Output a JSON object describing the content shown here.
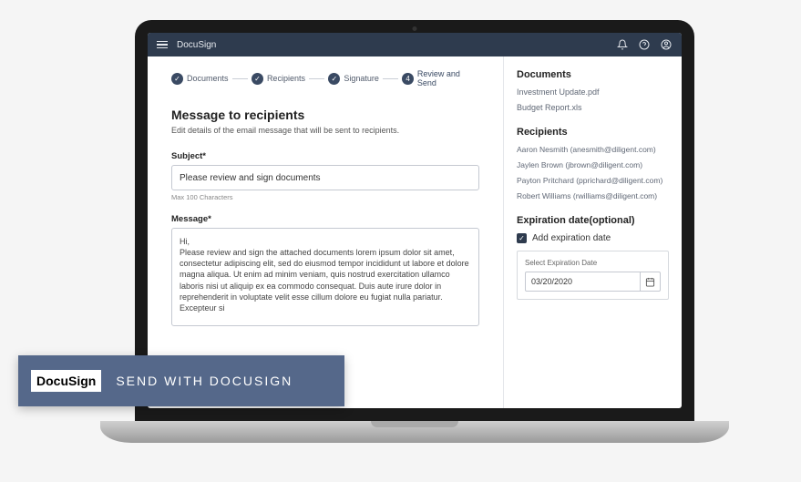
{
  "app": {
    "title": "DocuSign"
  },
  "stepper": [
    {
      "label": "Documents",
      "done": true
    },
    {
      "label": "Recipients",
      "done": true
    },
    {
      "label": "Signature",
      "done": true
    },
    {
      "label": "Review and Send",
      "active_num": "4"
    }
  ],
  "page": {
    "title": "Message to recipients",
    "subtitle": "Edit details of the email message that will be sent to recipients."
  },
  "form": {
    "subject_label": "Subject*",
    "subject_value": "Please review and sign documents",
    "subject_helper": "Max 100 Characters",
    "message_label": "Message*",
    "message_value": "Hi,\nPlease review and sign the attached documents lorem ipsum dolor sit amet, consectetur adipiscing elit, sed do eiusmod tempor incididunt ut labore et dolore magna aliqua. Ut enim ad minim veniam, quis nostrud exercitation ullamco laboris nisi ut aliquip ex ea commodo consequat. Duis aute irure dolor in reprehenderit in voluptate velit esse cillum dolore eu fugiat nulla pariatur. Excepteur si"
  },
  "documents": {
    "title": "Documents",
    "items": [
      "Investment Update.pdf",
      "Budget Report.xls"
    ]
  },
  "recipients": {
    "title": "Recipients",
    "items": [
      "Aaron Nesmith (anesmith@diligent.com)",
      "Jaylen Brown (jbrown@diligent.com)",
      "Payton Pritchard (pprichard@diligent.com)",
      "Robert Williams (rwilliams@diligent.com)"
    ]
  },
  "expiration": {
    "title": "Expiration date(optional)",
    "checkbox_label": "Add expiration date",
    "checked": true,
    "date_label": "Select Expiration Date",
    "date_value": "03/20/2020"
  },
  "banner": {
    "logo": "DocuSign",
    "text": "SEND WITH  DOCUSIGN"
  }
}
